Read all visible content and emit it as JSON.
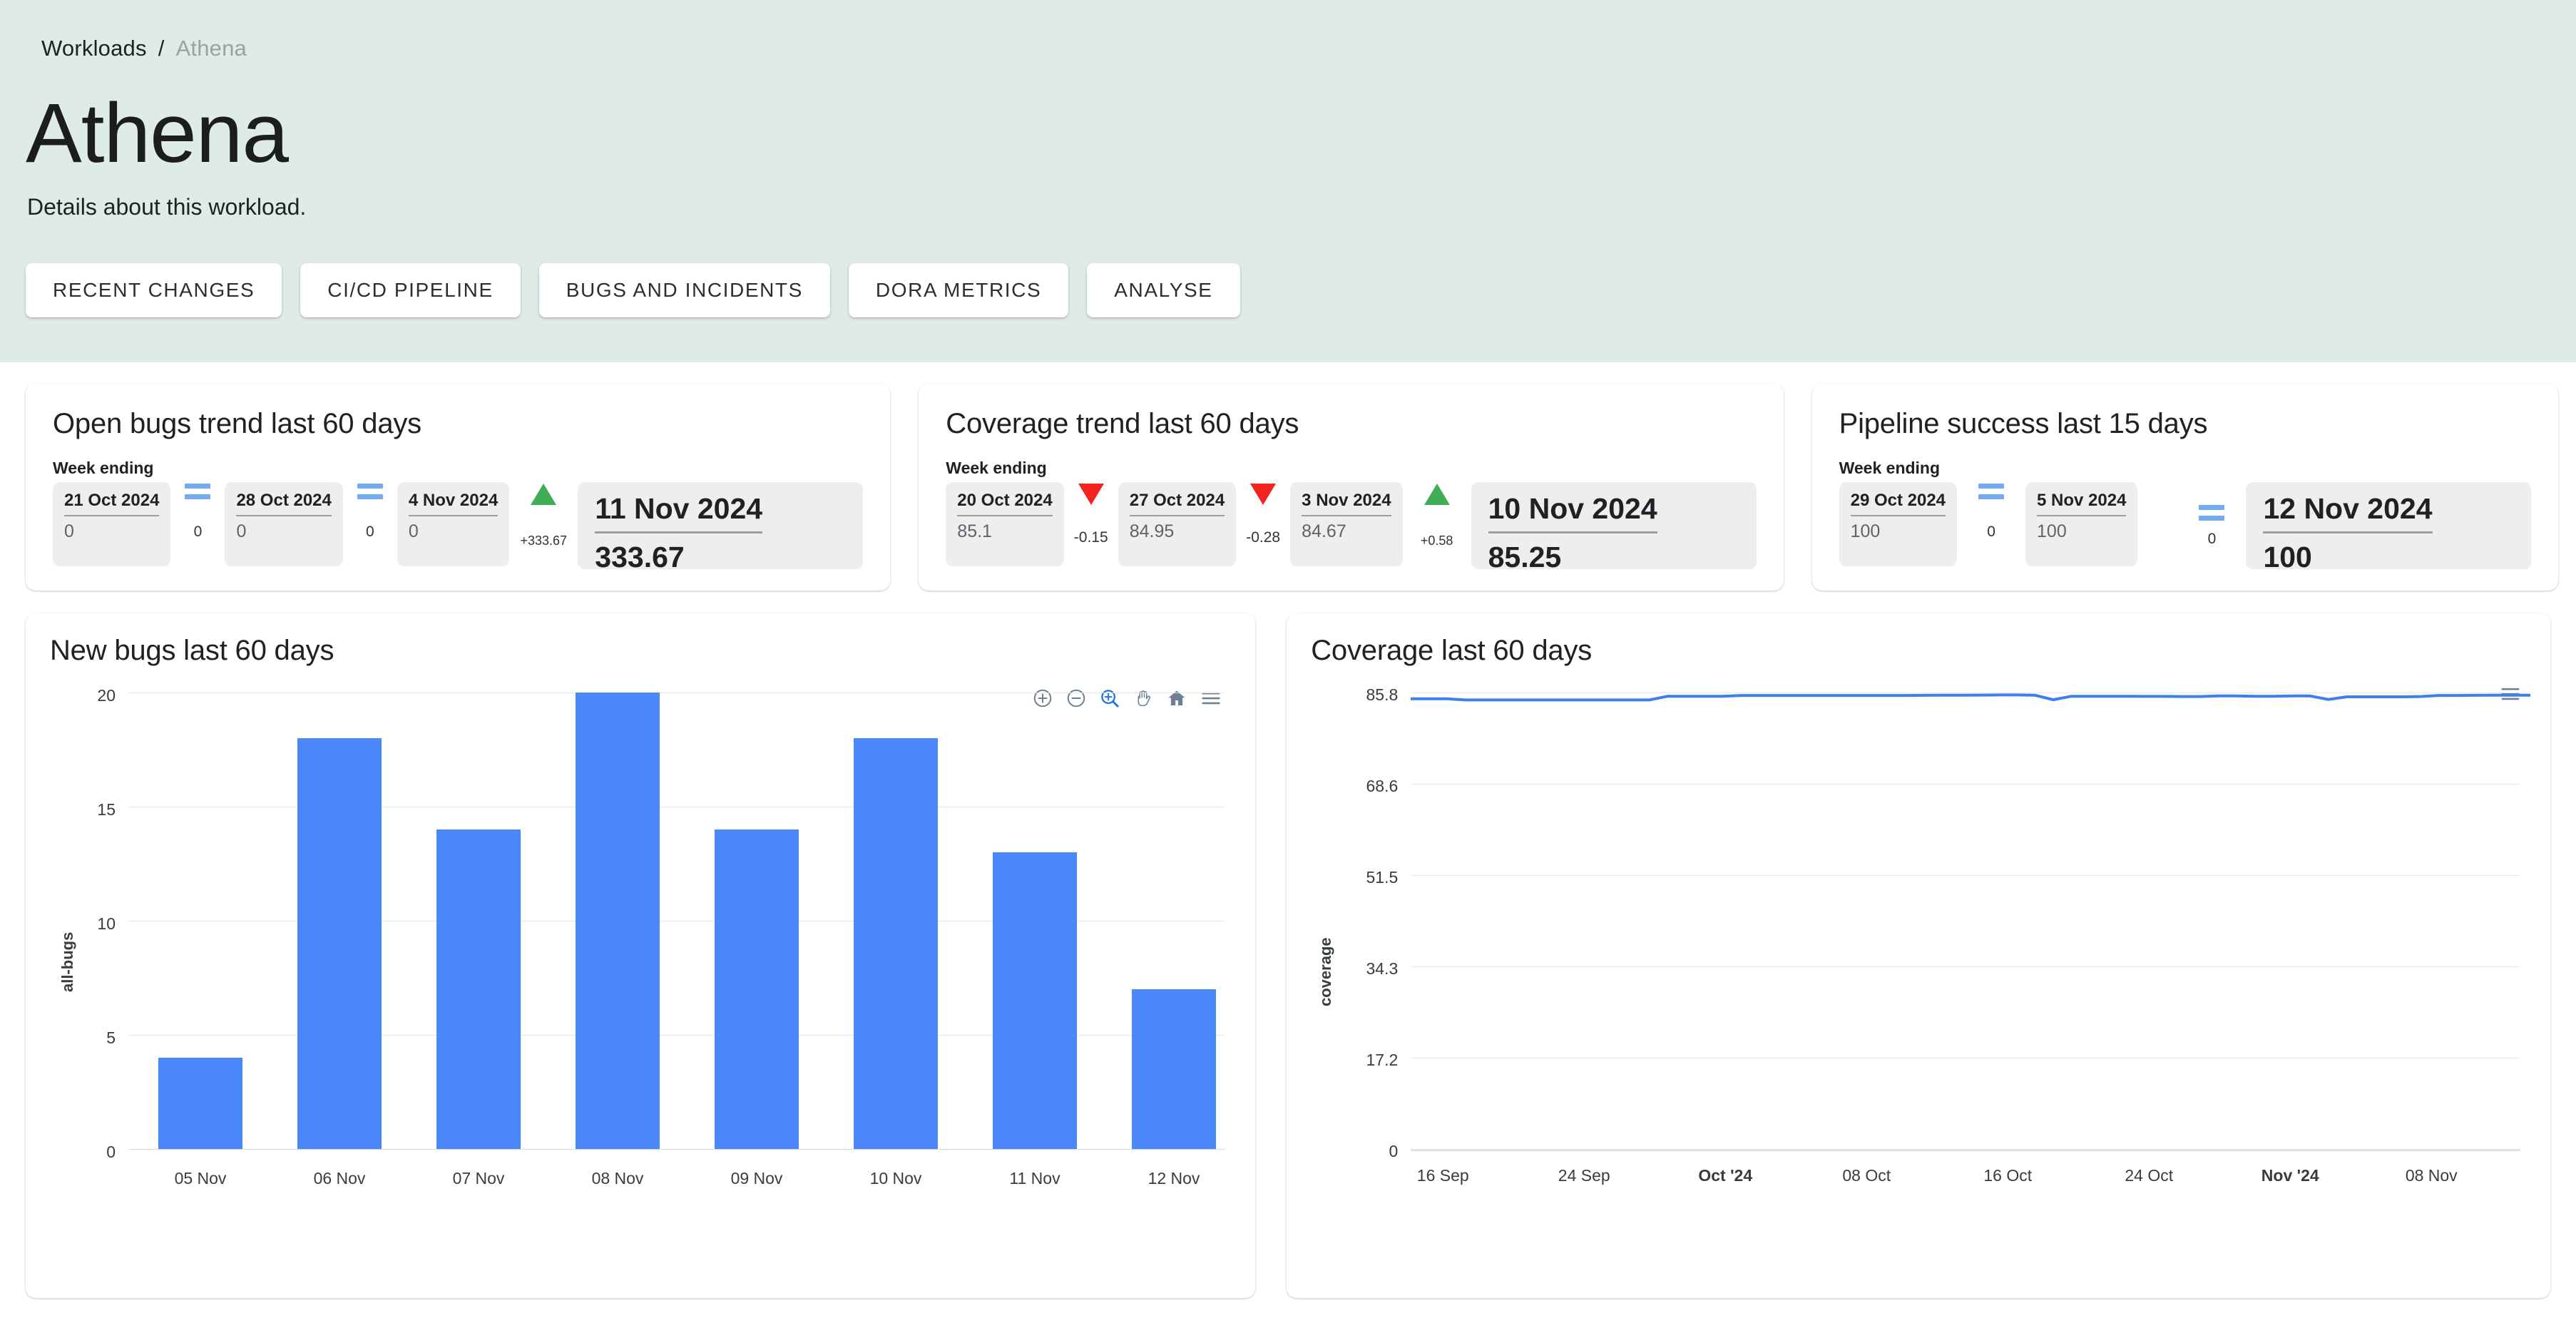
{
  "breadcrumb": {
    "root": "Workloads",
    "separator": "/",
    "current": "Athena"
  },
  "page": {
    "title": "Athena",
    "subtitle": "Details about this workload."
  },
  "tabs": [
    {
      "label": "RECENT CHANGES"
    },
    {
      "label": "CI/CD PIPELINE"
    },
    {
      "label": "BUGS AND INCIDENTS"
    },
    {
      "label": "DORA METRICS"
    },
    {
      "label": "ANALYSE"
    }
  ],
  "colors": {
    "header_bg": "#dfece5",
    "bar_blue": "#4a87f8",
    "line_blue": "#3e7ff0",
    "up_green": "#3fae57",
    "down_red": "#f4231f",
    "equal_blue": "#74aaf0"
  },
  "stat_cards": [
    {
      "title": "Open bugs trend last 60 days",
      "week_label": "Week ending",
      "steps": [
        {
          "date": "21 Oct 2024",
          "value": "0"
        },
        {
          "date": "28 Oct 2024",
          "value": "0"
        },
        {
          "date": "4 Nov 2024",
          "value": "0"
        }
      ],
      "indicators": [
        {
          "type": "equal",
          "delta": "0"
        },
        {
          "type": "equal",
          "delta": "0"
        },
        {
          "type": "up",
          "delta": "+333.67"
        }
      ],
      "latest": {
        "date": "11 Nov 2024",
        "value": "333.67"
      }
    },
    {
      "title": "Coverage trend last 60 days",
      "week_label": "Week ending",
      "steps": [
        {
          "date": "20 Oct 2024",
          "value": "85.1"
        },
        {
          "date": "27 Oct 2024",
          "value": "84.95"
        },
        {
          "date": "3 Nov 2024",
          "value": "84.67"
        }
      ],
      "indicators": [
        {
          "type": "down",
          "delta": "-0.15"
        },
        {
          "type": "down",
          "delta": "-0.28"
        },
        {
          "type": "up",
          "delta": "+0.58"
        }
      ],
      "latest": {
        "date": "10 Nov 2024",
        "value": "85.25"
      }
    },
    {
      "title": "Pipeline success last 15 days",
      "week_label": "Week ending",
      "steps": [
        {
          "date": "29 Oct 2024",
          "value": "100"
        },
        {
          "date": "5 Nov 2024",
          "value": "100"
        }
      ],
      "indicators": [
        {
          "type": "equal",
          "delta": "0"
        },
        {
          "type": "equal",
          "delta": "0"
        }
      ],
      "latest": {
        "date": "12 Nov 2024",
        "value": "100"
      }
    }
  ],
  "chart_cards": [
    {
      "title": "New bugs last 60 days"
    },
    {
      "title": "Coverage last 60 days"
    }
  ],
  "toolbar_icons": [
    {
      "name": "zoom-in-icon"
    },
    {
      "name": "zoom-out-icon"
    },
    {
      "name": "selection-zoom-icon"
    },
    {
      "name": "pan-icon"
    },
    {
      "name": "reset-home-icon"
    },
    {
      "name": "menu-icon"
    }
  ],
  "chart_data": [
    {
      "type": "bar",
      "title": "New bugs last 60 days",
      "categories": [
        "05 Nov",
        "06 Nov",
        "07 Nov",
        "08 Nov",
        "09 Nov",
        "10 Nov",
        "11 Nov",
        "12 Nov"
      ],
      "values": [
        4,
        18,
        14,
        20,
        14,
        18,
        13,
        7
      ],
      "xlabel": "",
      "ylabel": "all-bugs",
      "yticks": [
        "0",
        "5",
        "10",
        "15",
        "20"
      ],
      "ytickvals": [
        0,
        5,
        10,
        15,
        20
      ],
      "ylim": [
        0,
        20
      ],
      "grid": true,
      "legend": "none",
      "series_color": "#4a87f8"
    },
    {
      "type": "line",
      "title": "Coverage last 60 days",
      "xlabel": "",
      "ylabel": "coverage",
      "yticks": [
        "0",
        "17.2",
        "34.3",
        "51.5",
        "68.6",
        "85.8"
      ],
      "ytickvals": [
        0,
        17.2,
        34.3,
        51.5,
        68.6,
        85.8
      ],
      "ylim": [
        0,
        85.8
      ],
      "xticks": [
        {
          "label": "16 Sep",
          "bold": false
        },
        {
          "label": "24 Sep",
          "bold": false
        },
        {
          "label": "Oct '24",
          "bold": true
        },
        {
          "label": "08 Oct",
          "bold": false
        },
        {
          "label": "16 Oct",
          "bold": false
        },
        {
          "label": "24 Oct",
          "bold": false
        },
        {
          "label": "Nov '24",
          "bold": true
        },
        {
          "label": "08 Nov",
          "bold": false
        }
      ],
      "grid": true,
      "legend": "none",
      "series_color": "#3e7ff0",
      "values": [
        84.62,
        84.62,
        84.62,
        84.4,
        84.4,
        84.4,
        84.4,
        84.4,
        84.4,
        84.4,
        84.4,
        84.4,
        84.4,
        84.4,
        85.1,
        85.1,
        85.1,
        85.1,
        85.25,
        85.25,
        85.25,
        85.25,
        85.25,
        85.25,
        85.25,
        85.25,
        85.25,
        85.25,
        85.28,
        85.3,
        85.3,
        85.32,
        85.35,
        85.35,
        85.3,
        84.45,
        85.1,
        85.1,
        85.1,
        85.1,
        85.08,
        85.08,
        85.05,
        85.05,
        85.15,
        85.15,
        85.1,
        85.1,
        85.15,
        85.15,
        84.5,
        85.0,
        85.0,
        85.0,
        85.0,
        85.05,
        85.25,
        85.25,
        85.28,
        85.3,
        85.3,
        85.3
      ]
    }
  ]
}
